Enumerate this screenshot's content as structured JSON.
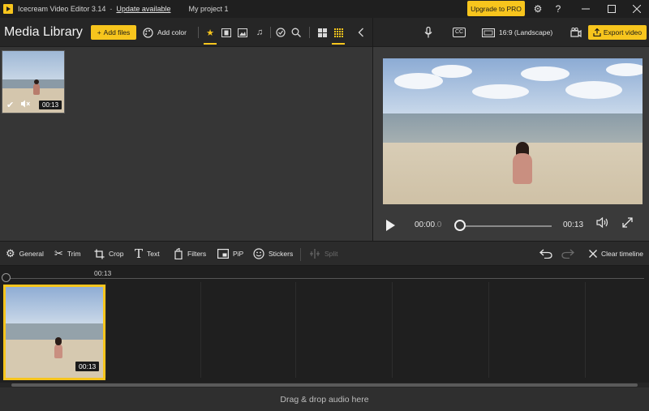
{
  "titlebar": {
    "app_name": "Icecream Video Editor 3.14",
    "separator": "-",
    "update_link": "Update available",
    "project_name": "My project 1",
    "upgrade_label": "Upgrade to PRO",
    "icons": [
      "gear-icon",
      "help-icon",
      "minimize-icon",
      "maximize-icon",
      "close-icon"
    ]
  },
  "library": {
    "title": "Media Library",
    "add_files_label": "Add files",
    "add_color_label": "Add color",
    "filter_icons": [
      "star-icon",
      "film-icon",
      "image-icon",
      "music-icon"
    ],
    "view_icons": [
      "check-filter-icon",
      "search-icon",
      "grid-large-icon",
      "grid-small-icon",
      "collapse-icon"
    ],
    "items": [
      {
        "duration": "00:13",
        "selected": true,
        "muted": true
      }
    ]
  },
  "preview": {
    "icons": [
      "microphone-icon",
      "captions-icon",
      "camera-icon"
    ],
    "captions_label": "CC",
    "aspect_label": "16:9 (Landscape)",
    "export_label": "Export video",
    "current_time_main": "00:00",
    "current_time_frac": ".0",
    "end_time": "00:13",
    "progress": 0
  },
  "toolbar": {
    "tools": [
      {
        "label": "General",
        "icon": "gear-icon"
      },
      {
        "label": "Trim",
        "icon": "scissors-icon"
      },
      {
        "label": "Crop",
        "icon": "crop-icon"
      },
      {
        "label": "Text",
        "icon": "text-icon"
      },
      {
        "label": "Filters",
        "icon": "filters-icon"
      },
      {
        "label": "PiP",
        "icon": "pip-icon"
      },
      {
        "label": "Stickers",
        "icon": "smiley-icon"
      },
      {
        "label": "Split",
        "icon": "split-icon",
        "disabled": true
      }
    ],
    "clear_label": "Clear timeline"
  },
  "timeline": {
    "ruler_label": "00:13",
    "clip_duration": "00:13"
  },
  "audio": {
    "drop_label": "Drag & drop audio here"
  },
  "colors": {
    "accent": "#f7c51d",
    "background": "#2b2b2b",
    "panel": "#363636"
  }
}
